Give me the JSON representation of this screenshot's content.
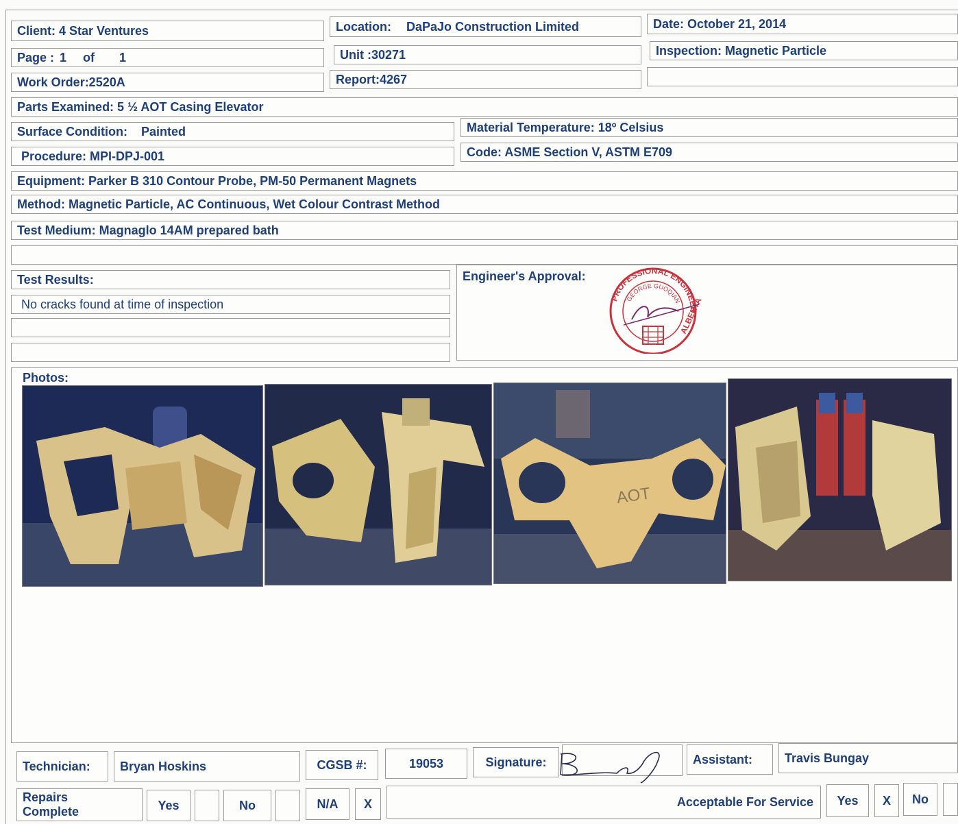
{
  "header": {
    "client": "Client:  4 Star Ventures",
    "location_label": "Location:",
    "location_value": "DaPaJo Construction Limited",
    "date": "Date: October 21, 2014",
    "page_label": "Page :",
    "page_num": "1",
    "page_of": "of",
    "page_total": "1",
    "unit": "Unit  :30271",
    "inspection": "Inspection:  Magnetic Particle",
    "work_order": "Work Order:2520A",
    "report": "Report:4267"
  },
  "details": {
    "parts_examined": "Parts Examined: 5 ½  AOT Casing Elevator",
    "surface_condition_label": "Surface Condition:",
    "surface_condition_value": "Painted",
    "material_temperature": "Material Temperature:  18º Celsius",
    "procedure": "Procedure: MPI-DPJ-001",
    "code": "Code: ASME Section V,  ASTM E709",
    "equipment": "Equipment:  Parker B 310 Contour Probe,  PM-50 Permanent Magnets",
    "method": "Method: Magnetic Particle, AC Continuous, Wet Colour Contrast Method",
    "test_medium": "Test Medium: Magnaglo 14AM prepared bath"
  },
  "results": {
    "label": "Test Results:",
    "line1": "No cracks found at time of inspection",
    "engineer_label": "Engineer's Approval:"
  },
  "stamp": {
    "text_top": "PROFESSIONAL ENGINEER",
    "text_name": "GEORGE GUOQIANG HE",
    "text_right": "ALBERTA"
  },
  "photos": {
    "label": "Photos:",
    "items": [
      "photo-elevator-front",
      "photo-elevator-side",
      "photo-elevator-top-aot",
      "photo-elevator-rear"
    ],
    "aot_text": "AOT"
  },
  "footer": {
    "technician_label": "Technician:",
    "technician_name": "Bryan Hoskins",
    "cgsb_label": "CGSB #:",
    "cgsb_value": "19053",
    "signature_label": "Signature:",
    "assistant_label": "Assistant:",
    "assistant_name": "Travis Bungay",
    "repairs_label_1": "Repairs",
    "repairs_label_2": "Complete",
    "yes": "Yes",
    "no": "No",
    "na": "N/A",
    "na_mark": "X",
    "acceptable_label": "Acceptable For Service",
    "acc_yes": "Yes",
    "acc_mark": "X",
    "acc_no": "No"
  },
  "colors": {
    "text": "#1f3f77",
    "border": "#9a9a9a",
    "stamp": "#c8323c"
  }
}
